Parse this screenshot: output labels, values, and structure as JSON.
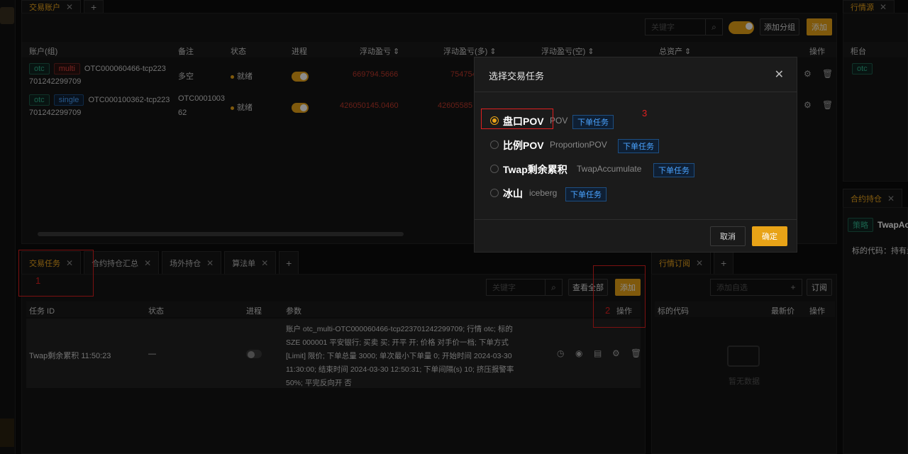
{
  "top_tabs": {
    "account_tab": "交易账户",
    "add": "+"
  },
  "right_top": {
    "tab": "行情源",
    "col": "柜台",
    "tag": "otc"
  },
  "right_mid": {
    "tab": "合约持仓",
    "strategy_tag": "策略",
    "strategy_name": "TwapAc",
    "code_label": "标的代码：持有量"
  },
  "account_toolbar": {
    "search_placeholder": "关键字",
    "add_group": "添加分组",
    "add": "添加"
  },
  "account_table": {
    "headers": [
      "账户(组)",
      "备注",
      "状态",
      "进程",
      "浮动盈亏 ⇕",
      "浮动盈亏(多) ⇕",
      "浮动盈亏(空) ⇕",
      "总资产 ⇕",
      "操作"
    ],
    "rows": [
      {
        "tag1": "otc",
        "tag2": "multi",
        "acct_line1": "OTC000060466-tcp223",
        "acct_line2": "701242299709",
        "note": "多空",
        "status": "就绪",
        "pnl": "669794.5666",
        "pnl_long": "754754"
      },
      {
        "tag1": "otc",
        "tag2": "single",
        "acct_line1": "OTC000100362-tcp223",
        "acct_line2": "701242299709",
        "note_line1": "OTC0001003",
        "note_line2": "62",
        "status": "就绪",
        "pnl": "426050145.0460",
        "pnl_long": "42605585"
      }
    ]
  },
  "bottom_tabs": {
    "t1": "交易任务",
    "t2": "合约持仓汇总",
    "t3": "场外持仓",
    "t4": "算法单",
    "add": "+"
  },
  "task_toolbar": {
    "search_placeholder": "关键字",
    "view_all": "查看全部",
    "add": "添加"
  },
  "task_table": {
    "headers": [
      "任务 ID",
      "状态",
      "进程",
      "参数",
      "操作"
    ],
    "row": {
      "id": "Twap剩余累积 11:50:23",
      "status": "—",
      "params": [
        "账户 otc_multi-OTC000060466-tcp223701242299709; 行情 otc; 标的",
        "SZE 000001 平安银行; 买卖 买; 开平 开; 价格 对手价一档; 下单方式",
        "[Limit] 限价; 下单总量 3000; 单次最小下单量 0; 开始时间 2024-03-30",
        "11:30:00; 结束时间 2024-03-30 12:50:31; 下单间隔(s) 10; 挤压报警率",
        "50%; 平完反向开 否"
      ]
    }
  },
  "market_sub": {
    "tab": "行情订阅",
    "add": "+",
    "input_placeholder": "添加自选",
    "subscribe": "订阅",
    "col1": "标的代码",
    "col2": "最新价",
    "col3": "操作",
    "empty": "暂无数据"
  },
  "modal": {
    "title": "选择交易任务",
    "options": [
      {
        "name": "盘口POV",
        "en": "POV",
        "badge": "下单任务",
        "checked": true
      },
      {
        "name": "比例POV",
        "en": "ProportionPOV",
        "badge": "下单任务",
        "checked": false
      },
      {
        "name": "Twap剩余累积",
        "en": "TwapAccumulate",
        "badge": "下单任务",
        "checked": false
      },
      {
        "name": "冰山",
        "en": "iceberg",
        "badge": "下单任务",
        "checked": false
      }
    ],
    "cancel": "取消",
    "confirm": "确定"
  },
  "annotations": {
    "a1": "1",
    "a2": "2",
    "a3": "3"
  },
  "colors": {
    "accent": "#e8a317",
    "annotation": "#e02020",
    "loss": "#c0392b"
  }
}
